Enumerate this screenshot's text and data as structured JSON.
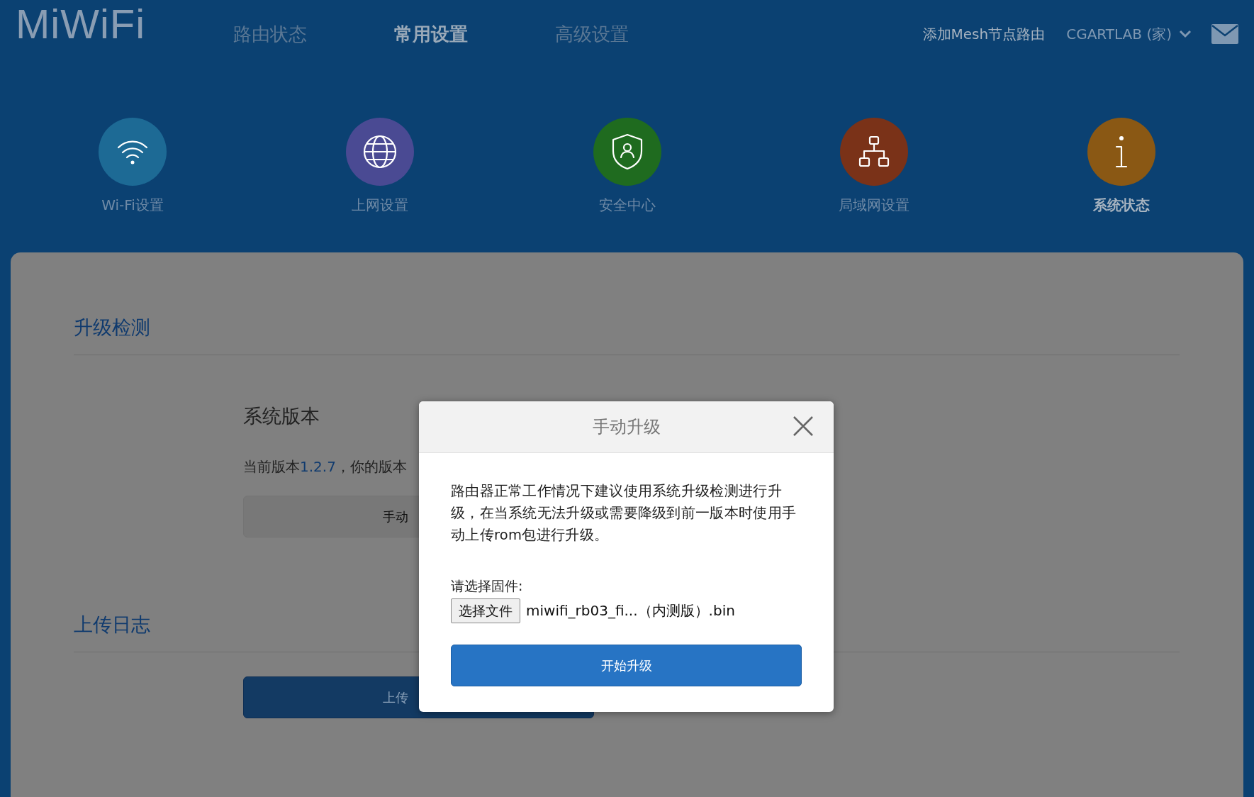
{
  "header": {
    "logo": "MiWiFi",
    "nav": [
      {
        "label": "路由状态",
        "selected": false
      },
      {
        "label": "常用设置",
        "selected": true
      },
      {
        "label": "高级设置",
        "selected": false
      }
    ],
    "add_mesh": "添加Mesh节点路由",
    "account": "CGARTLAB (家)"
  },
  "shortcuts": [
    {
      "kind": "wifi",
      "label": "Wi-Fi设置",
      "color": "#1d6a95",
      "selected": false
    },
    {
      "kind": "globe",
      "label": "上网设置",
      "color": "#4a4a93",
      "selected": false
    },
    {
      "kind": "shield",
      "label": "安全中心",
      "color": "#1f6b1f",
      "selected": false
    },
    {
      "kind": "lan",
      "label": "局域网设置",
      "color": "#7a3218",
      "selected": false
    },
    {
      "kind": "info",
      "label": "系统状态",
      "color": "#8a5814",
      "selected": true
    }
  ],
  "sections": [
    {
      "title": "升级检测",
      "subtitle": "系统版本",
      "version_prefix": "当前版本",
      "version": "1.2.7",
      "version_suffix": "，你的版本",
      "button": "手动",
      "kind": "plain"
    },
    {
      "title": "上传日志",
      "button": "上传",
      "kind": "primary"
    }
  ],
  "modal": {
    "title": "手动升级",
    "text": "路由器正常工作情况下建议使用系统升级检测进行升级，在当系统无法升级或需要降级到前一版本时使用手动上传rom包进行升级。",
    "file_label": "请选择固件:",
    "file_button": "选择文件",
    "file_name": "miwifi_rb03_fi...（内测版）.bin",
    "submit": "开始升级"
  }
}
